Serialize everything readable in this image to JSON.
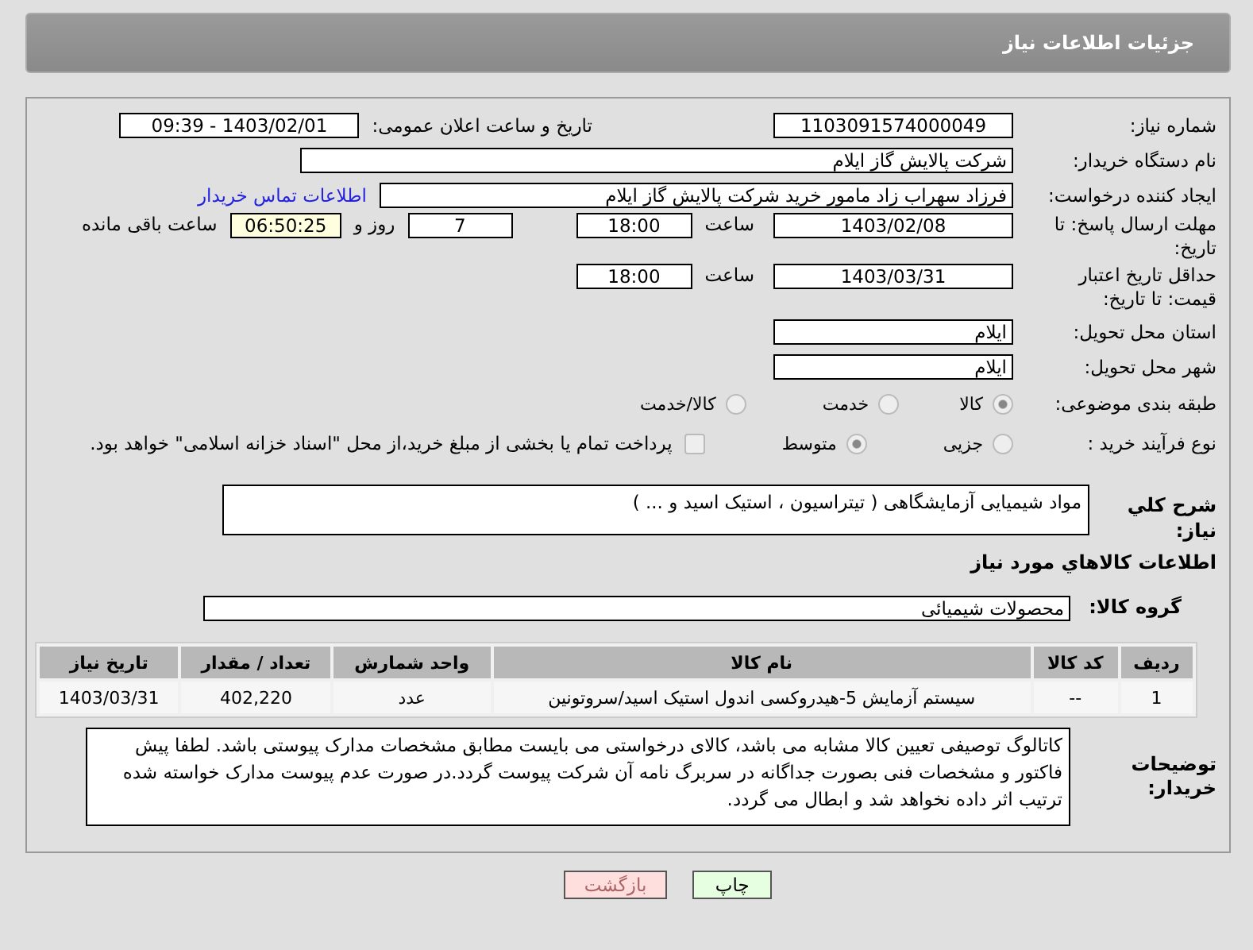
{
  "header": {
    "title": "جزئیات اطلاعات نیاز"
  },
  "need_number": {
    "label": "شماره نیاز:",
    "value": "1103091574000049"
  },
  "announce": {
    "label": "تاریخ و ساعت اعلان عمومی:",
    "value": "1403/02/01 - 09:39"
  },
  "buyer": {
    "label": "نام دستگاه خریدار:",
    "value": "شرکت پالایش گاز ایلام"
  },
  "creator": {
    "label": "ایجاد کننده درخواست:",
    "value": "فرزاد سهراب زاد مامور خرید شرکت پالایش گاز ایلام",
    "link": "اطلاعات تماس خریدار"
  },
  "deadline": {
    "label": "مهلت ارسال پاسخ: تا تاریخ:",
    "date": "1403/02/08",
    "time_label": "ساعت",
    "time": "18:00",
    "days": "7",
    "days_label": "روز و",
    "remaining": "06:50:25",
    "remaining_label": "ساعت باقی مانده"
  },
  "validity": {
    "label": "حداقل تاریخ اعتبار قیمت: تا تاریخ:",
    "date": "1403/03/31",
    "time_label": "ساعت",
    "time": "18:00"
  },
  "province": {
    "label": "استان محل تحویل:",
    "value": "ایلام"
  },
  "city": {
    "label": "شهر محل تحویل:",
    "value": "ایلام"
  },
  "category": {
    "label": "طبقه بندی موضوعی:",
    "options": [
      {
        "label": "کالا",
        "selected": true
      },
      {
        "label": "خدمت",
        "selected": false
      },
      {
        "label": "کالا/خدمت",
        "selected": false
      }
    ]
  },
  "process": {
    "label": "نوع فرآیند خرید :",
    "options": [
      {
        "label": "جزیی",
        "selected": false
      },
      {
        "label": "متوسط",
        "selected": true
      }
    ],
    "payment": {
      "label": "پرداخت تمام یا بخشی از مبلغ خرید،از محل \"اسناد خزانه اسلامی\" خواهد بود.",
      "checked": false
    }
  },
  "description": {
    "label": "شرح کلي نياز:",
    "value": "مواد شیمیایی آزمایشگاهی ( تیتراسیون ، استیک اسید و ... )"
  },
  "goods_title": "اطلاعات کالاهاي مورد نياز",
  "goods_group": {
    "label": "گروه کالا:",
    "value": "محصولات شیمیائی"
  },
  "table": {
    "columns": [
      "ردیف",
      "کد کالا",
      "نام کالا",
      "واحد شمارش",
      "تعداد / مقدار",
      "تاریخ نیاز"
    ],
    "rows": [
      [
        "1",
        "--",
        "سیستم آزمایش 5-هیدروکسی اندول استیک اسید/سروتونین",
        "عدد",
        "402,220",
        "1403/03/31"
      ]
    ]
  },
  "buyer_notes": {
    "label": "توضیحات خریدار:",
    "value": "کاتالوگ توصیفی تعیین کالا مشابه می باشد، کالای درخواستی می بایست مطابق مشخصات مدارک پیوستی باشد. لطفا پیش فاکتور و مشخصات فنی بصورت جداگانه در سربرگ نامه آن شرکت پیوست گردد.در صورت عدم پیوست مدارک خواسته شده ترتیب اثر داده نخواهد شد و ابطال می گردد."
  },
  "buttons": [
    {
      "label": "چاپ",
      "kind": "print"
    },
    {
      "label": "بازگشت",
      "kind": "back"
    }
  ]
}
